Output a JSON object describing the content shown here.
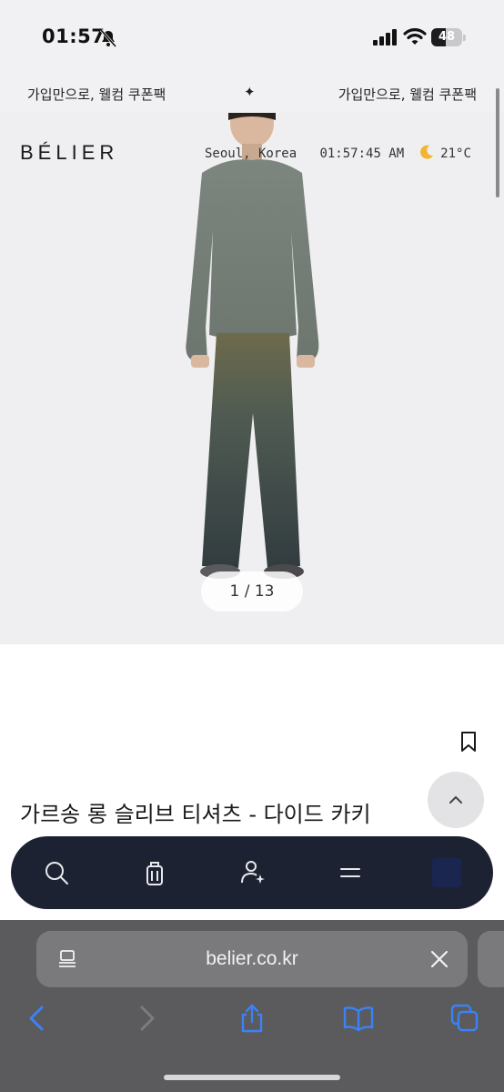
{
  "status_bar": {
    "time": "01:57",
    "battery_level": "48",
    "battery_fraction": 0.48,
    "icons": [
      "bell-slash-icon",
      "cellular-signal-icon",
      "wifi-icon",
      "battery-icon"
    ]
  },
  "promo": {
    "left_text": "가입만으로, 웰컴 쿠폰팩",
    "separator": "✦",
    "right_text": "가입만으로, 웰컴 쿠폰팩"
  },
  "header": {
    "logo": "BÉLIER",
    "location": "Seoul, Korea",
    "clock": "01:57:45 AM",
    "weather_icon": "moon-icon",
    "temperature": "21°C"
  },
  "gallery": {
    "counter": "1 / 13"
  },
  "product": {
    "title": "가르송 롱 슬리브 티셔츠 - 다이드 카키"
  },
  "bottom_nav": {
    "items": [
      "search-icon",
      "shopping-bag-icon",
      "account-icon",
      "menu-icon"
    ]
  },
  "browser": {
    "url": "belier.co.kr",
    "toolbar": [
      "back-icon",
      "forward-icon",
      "share-icon",
      "bookmarks-icon",
      "tabs-icon"
    ]
  },
  "colors": {
    "nav_background": "#1d2233",
    "accent_blue": "#3b82f6",
    "hero_background": "#efeff1"
  }
}
